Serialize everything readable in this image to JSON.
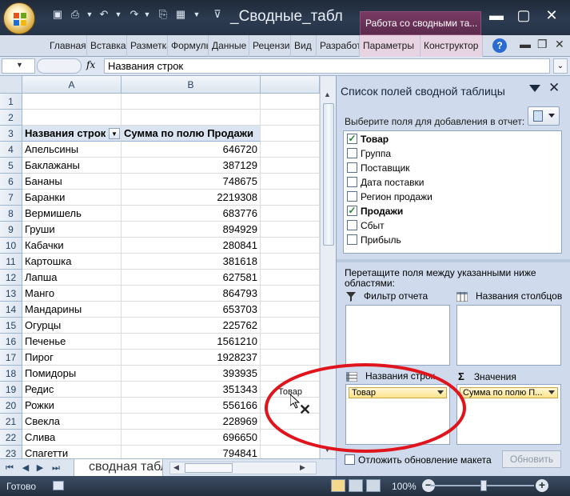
{
  "window": {
    "doc_title": "_Сводные_табл",
    "context_tab": "Работа со сводными та...",
    "min": "▬",
    "max": "▢",
    "close": "✕"
  },
  "ribbon_tabs": [
    "Главная",
    "Вставка",
    "Разметка",
    "Формулы",
    "Данные",
    "Рецензирование",
    "Вид",
    "Разработчик",
    "Параметры",
    "Конструктор"
  ],
  "formula_bar": {
    "fx": "fx",
    "content": "Названия строк"
  },
  "columns": [
    "A",
    "B"
  ],
  "rows": [
    {
      "n": "1",
      "a": "",
      "b": ""
    },
    {
      "n": "2",
      "a": "",
      "b": ""
    },
    {
      "n": "3",
      "a": "Названия строк",
      "b": "Сумма по полю Продажи"
    },
    {
      "n": "4",
      "a": "Апельсины",
      "b": "646720"
    },
    {
      "n": "5",
      "a": "Баклажаны",
      "b": "387129"
    },
    {
      "n": "6",
      "a": "Бананы",
      "b": "748675"
    },
    {
      "n": "7",
      "a": "Баранки",
      "b": "2219308"
    },
    {
      "n": "8",
      "a": "Вермишель",
      "b": "683776"
    },
    {
      "n": "9",
      "a": "Груши",
      "b": "894929"
    },
    {
      "n": "10",
      "a": "Кабачки",
      "b": "280841"
    },
    {
      "n": "11",
      "a": "Картошка",
      "b": "381618"
    },
    {
      "n": "12",
      "a": "Лапша",
      "b": "627581"
    },
    {
      "n": "13",
      "a": "Манго",
      "b": "864793"
    },
    {
      "n": "14",
      "a": "Мандарины",
      "b": "653703"
    },
    {
      "n": "15",
      "a": "Огурцы",
      "b": "225762"
    },
    {
      "n": "16",
      "a": "Печенье",
      "b": "1561210"
    },
    {
      "n": "17",
      "a": "Пирог",
      "b": "1928237"
    },
    {
      "n": "18",
      "a": "Помидоры",
      "b": "393935"
    },
    {
      "n": "19",
      "a": "Редис",
      "b": "351343"
    },
    {
      "n": "20",
      "a": "Рожки",
      "b": "556166"
    },
    {
      "n": "21",
      "a": "Свекла",
      "b": "228969"
    },
    {
      "n": "22",
      "a": "Слива",
      "b": "696650"
    },
    {
      "n": "23",
      "a": "Спагетти",
      "b": "794841"
    }
  ],
  "sheet_tab": "сводная табл",
  "status": {
    "ready": "Готово",
    "zoom": "100%"
  },
  "panel": {
    "title": "Список полей сводной таблицы",
    "instruction": "Выберите поля для добавления в отчет:",
    "fields": [
      {
        "label": "Товар",
        "checked": true
      },
      {
        "label": "Группа",
        "checked": false
      },
      {
        "label": "Поставщик",
        "checked": false
      },
      {
        "label": "Дата поставки",
        "checked": false
      },
      {
        "label": "Регион продажи",
        "checked": false
      },
      {
        "label": "Продажи",
        "checked": true
      },
      {
        "label": "Сбыт",
        "checked": false
      },
      {
        "label": "Прибыль",
        "checked": false
      }
    ],
    "drag_instruction": "Перетащите поля между указанными ниже областями:",
    "zones": {
      "report_filter": "Фильтр отчета",
      "column_labels": "Названия столбцов",
      "row_labels": "Названия строк",
      "values": "Значения"
    },
    "row_chip": "Товар",
    "values_chip": "Сумма по полю П...",
    "defer_label": "Отложить обновление макета",
    "update_button": "Обновить"
  },
  "drag_ghost": "Товар",
  "colors": {
    "checkmark": "#1d8a2e",
    "oval": "#e0141c",
    "chip": "#fde48c"
  }
}
